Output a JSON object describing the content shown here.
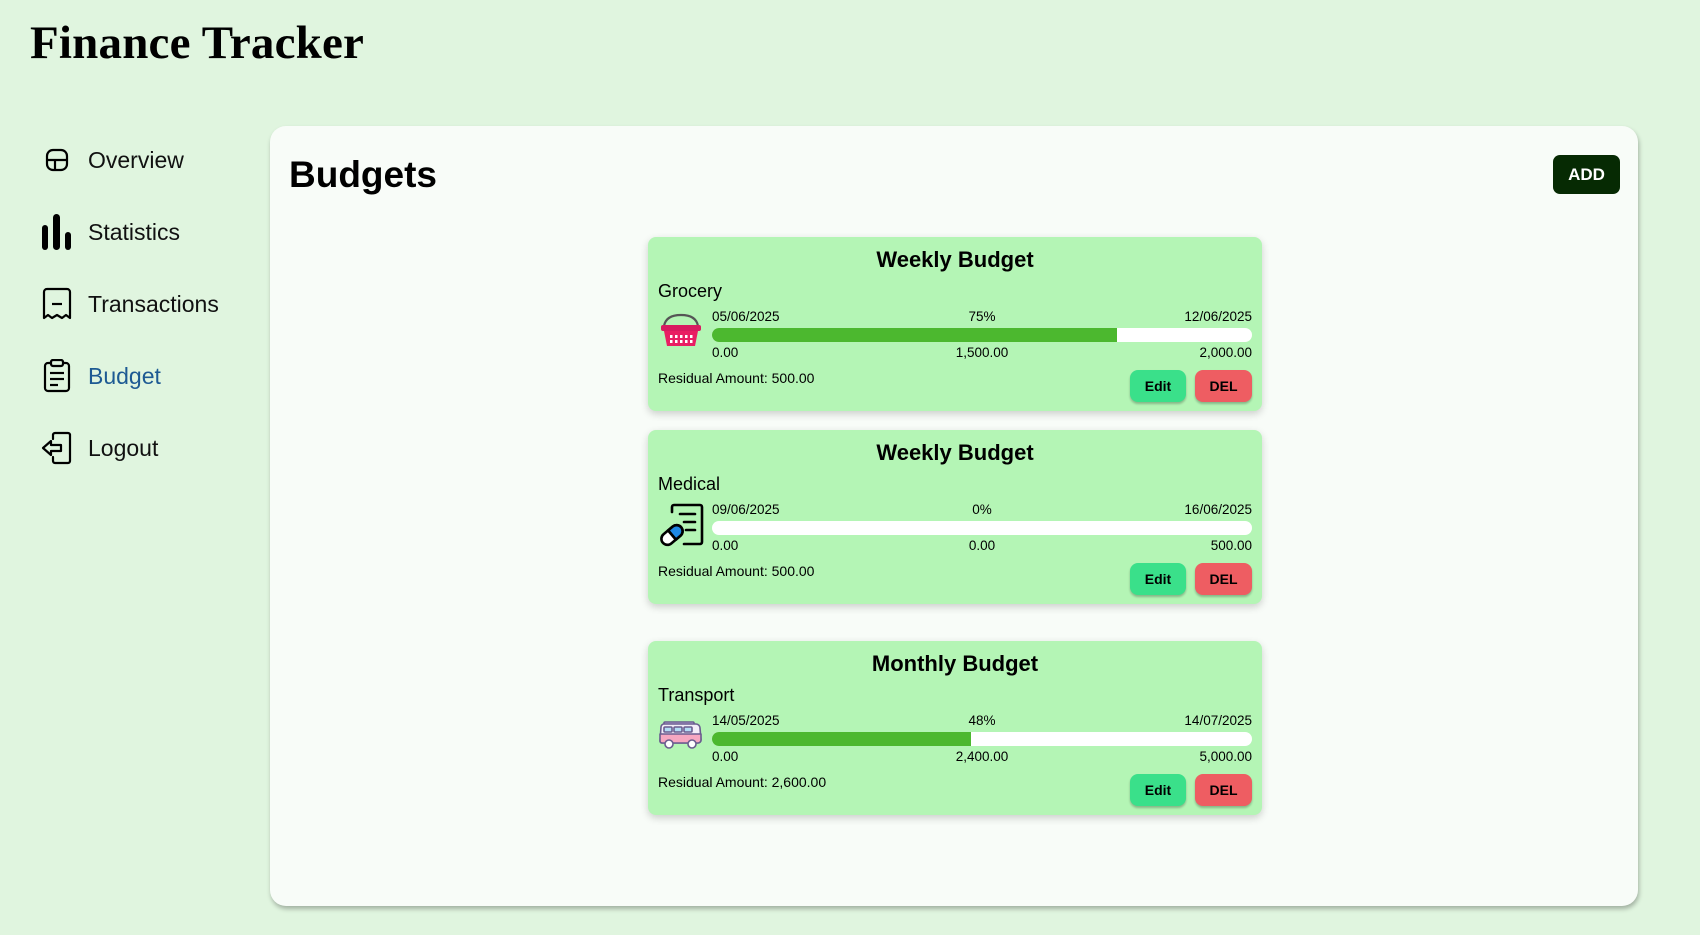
{
  "app": {
    "title": "Finance Tracker"
  },
  "sidebar": {
    "items": [
      {
        "label": "Overview",
        "icon": "overview-icon"
      },
      {
        "label": "Statistics",
        "icon": "bar-chart-icon"
      },
      {
        "label": "Transactions",
        "icon": "receipt-icon"
      },
      {
        "label": "Budget",
        "icon": "clipboard-icon",
        "active": true
      },
      {
        "label": "Logout",
        "icon": "logout-icon"
      }
    ]
  },
  "main": {
    "title": "Budgets",
    "add_label": "ADD",
    "budgets": [
      {
        "title": "Weekly Budget",
        "category": "Grocery",
        "icon": "grocery-basket-icon",
        "start_date": "05/06/2025",
        "percent": "75%",
        "progress": 0.75,
        "end_date": "12/06/2025",
        "min": "0.00",
        "spent": "1,500.00",
        "limit": "2,000.00",
        "residual": "Residual Amount: 500.00",
        "edit_label": "Edit",
        "del_label": "DEL"
      },
      {
        "title": "Weekly Budget",
        "category": "Medical",
        "icon": "medical-prescription-icon",
        "start_date": "09/06/2025",
        "percent": "0%",
        "progress": 0,
        "end_date": "16/06/2025",
        "min": "0.00",
        "spent": "0.00",
        "limit": "500.00",
        "residual": "Residual Amount: 500.00",
        "edit_label": "Edit",
        "del_label": "DEL"
      },
      {
        "title": "Monthly Budget",
        "category": "Transport",
        "icon": "bus-icon",
        "start_date": "14/05/2025",
        "percent": "48%",
        "progress": 0.48,
        "end_date": "14/07/2025",
        "min": "0.00",
        "spent": "2,400.00",
        "limit": "5,000.00",
        "residual": "Residual Amount: 2,600.00",
        "edit_label": "Edit",
        "del_label": "DEL"
      }
    ]
  },
  "colors": {
    "background": "#e0f5df",
    "card": "#b4f5b5",
    "progress": "#4cb82f",
    "edit": "#3ae08a",
    "delete": "#ee5d62",
    "add": "#062a03",
    "active_nav": "#1d5a93"
  }
}
